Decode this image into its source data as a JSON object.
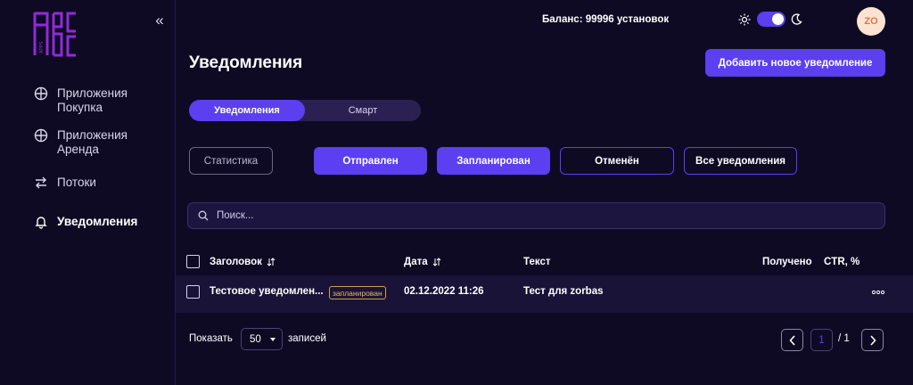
{
  "app": {
    "logo_text": "APPS"
  },
  "sidebar": {
    "items": [
      {
        "label": "Приложения Покупка",
        "icon": "globe-icon",
        "active": false
      },
      {
        "label": "Приложения Аренда",
        "icon": "globe-icon",
        "active": false
      },
      {
        "label": "Потоки",
        "icon": "swap-arrows-icon",
        "active": false
      },
      {
        "label": "Уведомления",
        "icon": "bell-icon",
        "active": true
      }
    ]
  },
  "header": {
    "balance": "Баланс: 99996 установок",
    "theme": "dark",
    "avatar_initials": "ZO"
  },
  "main": {
    "title": "Уведомления",
    "add_button": "Добавить новое уведомление",
    "tabs": [
      {
        "label": "Уведомления",
        "active": true
      },
      {
        "label": "Смарт",
        "active": false
      }
    ],
    "stats_button": "Статистика",
    "filters": [
      {
        "label": "Отправлен",
        "active": true
      },
      {
        "label": "Запланирован",
        "active": true
      },
      {
        "label": "Отменён",
        "active": false
      },
      {
        "label": "Все уведомления",
        "active": false
      }
    ],
    "search": {
      "placeholder": "Поиск...",
      "value": ""
    }
  },
  "table": {
    "columns": [
      "Заголовок",
      "Дата",
      "Текст",
      "Получено",
      "CTR, %"
    ],
    "rows": [
      {
        "title": "Тестовое уведомлен...",
        "status": "запланирован",
        "date": "02.12.2022 11:26",
        "text": "Тест для zorbas",
        "received": "",
        "ctr": ""
      }
    ]
  },
  "pagination": {
    "show_label": "Показать",
    "per_page": "50",
    "records_label": "записей",
    "current_page": "1",
    "total_pages": "/ 1"
  },
  "colors": {
    "background": "#0f0a24",
    "accent": "#5b3ff0",
    "badge": "#e7b860"
  }
}
